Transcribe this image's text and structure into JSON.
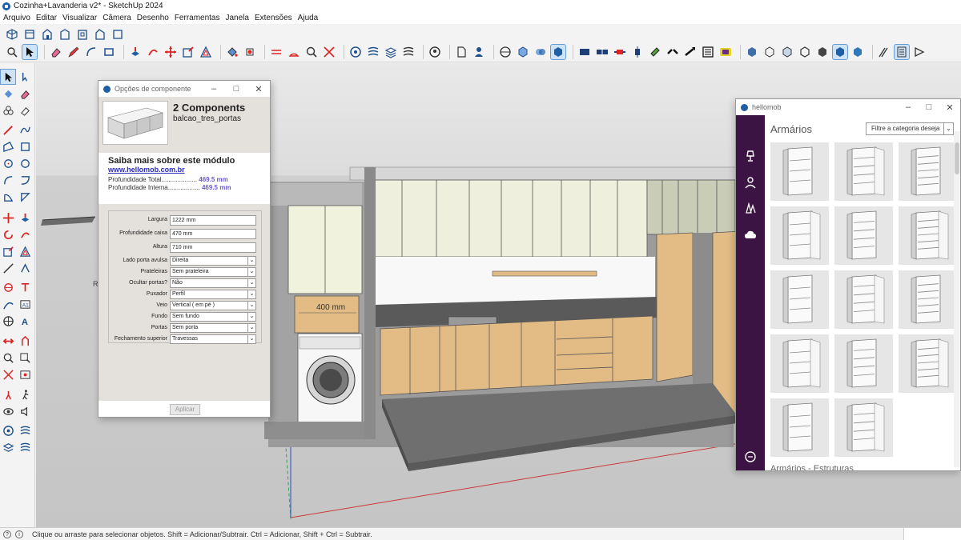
{
  "window": {
    "title": "Cozinha+Lavanderia v2* - SketchUp 2024"
  },
  "menu": [
    "Arquivo",
    "Editar",
    "Visualizar",
    "Câmera",
    "Desenho",
    "Ferramentas",
    "Janela",
    "Extensões",
    "Ajuda"
  ],
  "viewport": {
    "dimension_label": "400 mm",
    "axis_label": "R"
  },
  "component_dialog": {
    "title": "Opções de componente",
    "component_name": "2 Components",
    "definition_name": "balcao_tres_portas",
    "info_title": "Saiba mais sobre este módulo",
    "info_link": "www.hellomob.com.br",
    "depth_total_label": "Profundidade Total....................",
    "depth_total_value": "469.5 mm",
    "depth_internal_label": "Profundidade Interna..................",
    "depth_internal_value": "469.5 mm",
    "fields": [
      {
        "label": "Largura",
        "value": "1222 mm",
        "kind": "input"
      },
      {
        "label": "Profundidade caixa",
        "value": "470 mm",
        "kind": "input"
      },
      {
        "label": "Altura",
        "value": "710 mm",
        "kind": "input"
      },
      {
        "label": "Lado porta avulsa",
        "value": "Direita",
        "kind": "select"
      },
      {
        "label": "Prateleiras",
        "value": "Sem prateleira",
        "kind": "select"
      },
      {
        "label": "Ocultar portas?",
        "value": "Não",
        "kind": "select"
      },
      {
        "label": "Puxador",
        "value": "Perfil",
        "kind": "select"
      },
      {
        "label": "Veio",
        "value": "Vertical ( em pé )",
        "kind": "select"
      },
      {
        "label": "Fundo",
        "value": "Sem fundo",
        "kind": "select"
      },
      {
        "label": "Portas",
        "value": "Sem porta",
        "kind": "select"
      },
      {
        "label": "Fechamento superior",
        "value": "Travessas",
        "kind": "select"
      }
    ],
    "apply_label": "Aplicar"
  },
  "hellomob": {
    "title": "hellomob",
    "heading": "Armários",
    "filter_placeholder": "Filtre a categoria deseja",
    "subheading": "Armários - Estruturas",
    "cards": [
      "armario-1",
      "armario-2",
      "armario-3",
      "armario-4",
      "armario-5",
      "armario-6",
      "armario-7",
      "armario-8",
      "armario-9",
      "armario-10",
      "armario-11",
      "armario-12",
      "armario-13",
      "armario-14"
    ]
  },
  "statusbar": {
    "text": "Clique ou arraste para selecionar objetos. Shift = Adicionar/Subtrair. Ctrl = Adicionar, Shift + Ctrl = Subtrair."
  },
  "colors": {
    "accent": "#1f5fa6",
    "hellomob_sidebar": "#3b1443",
    "wood": "#e2bb85",
    "cabinet_light": "#eef0dd"
  }
}
